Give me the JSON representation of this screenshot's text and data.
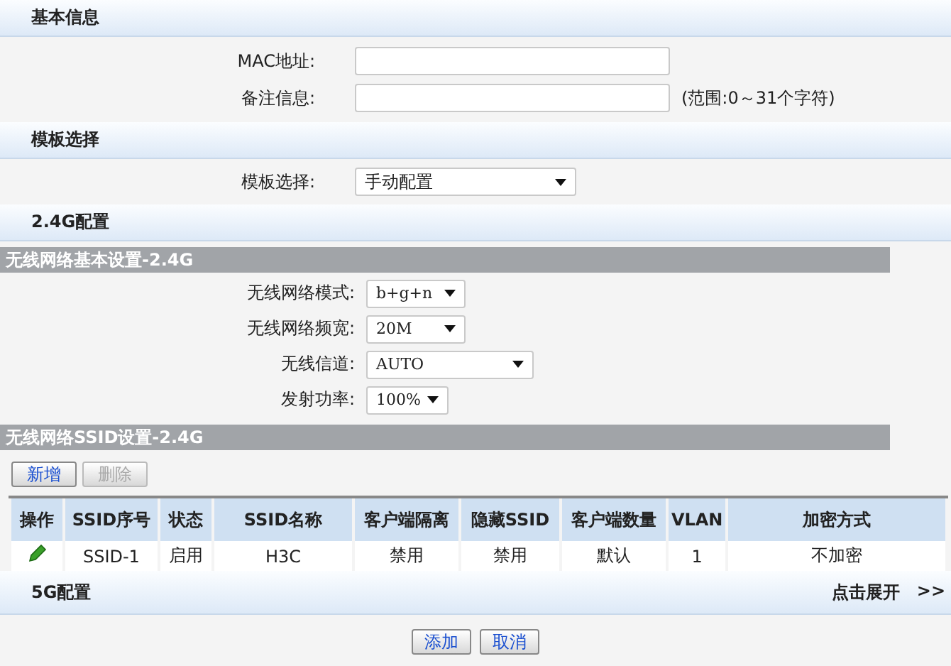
{
  "basic_info": {
    "title": "基本信息",
    "fields": [
      {
        "label": "MAC地址:"
      },
      {
        "label": "备注信息:",
        "hint": "(范围:0～31个字符)"
      }
    ]
  },
  "template": {
    "title": "模板选择",
    "label": "模板选择:",
    "value": "手动配置"
  },
  "config_24g": {
    "title": "2.4G配置",
    "basic_settings": {
      "title": "无线网络基本设置-2.4G",
      "fields": [
        {
          "label": "无线网络模式:",
          "value": "b+g+n"
        },
        {
          "label": "无线网络频宽:",
          "value": "20M"
        },
        {
          "label": "无线信道:",
          "value": "AUTO"
        },
        {
          "label": "发射功率:",
          "value": "100%"
        }
      ]
    },
    "ssid_settings": {
      "title": "无线网络SSID设置-2.4G",
      "buttons": [
        {
          "label": "新增",
          "disabled": false
        },
        {
          "label": "删除",
          "disabled": true
        }
      ],
      "table": {
        "columns": [
          "操作",
          "SSID序号",
          "状态",
          "SSID名称",
          "客户端隔离",
          "隐藏SSID",
          "客户端数量",
          "VLAN",
          "加密方式"
        ],
        "rows": [
          [
            "",
            "SSID-1",
            "启用",
            "H3C",
            "禁用",
            "禁用",
            "默认",
            "1",
            "不加密"
          ]
        ]
      }
    }
  },
  "config_5g": {
    "title": "5G配置",
    "expand_link": "点击展开",
    "expand_arrow": ">>"
  },
  "buttons": [
    "添加",
    "取消"
  ]
}
